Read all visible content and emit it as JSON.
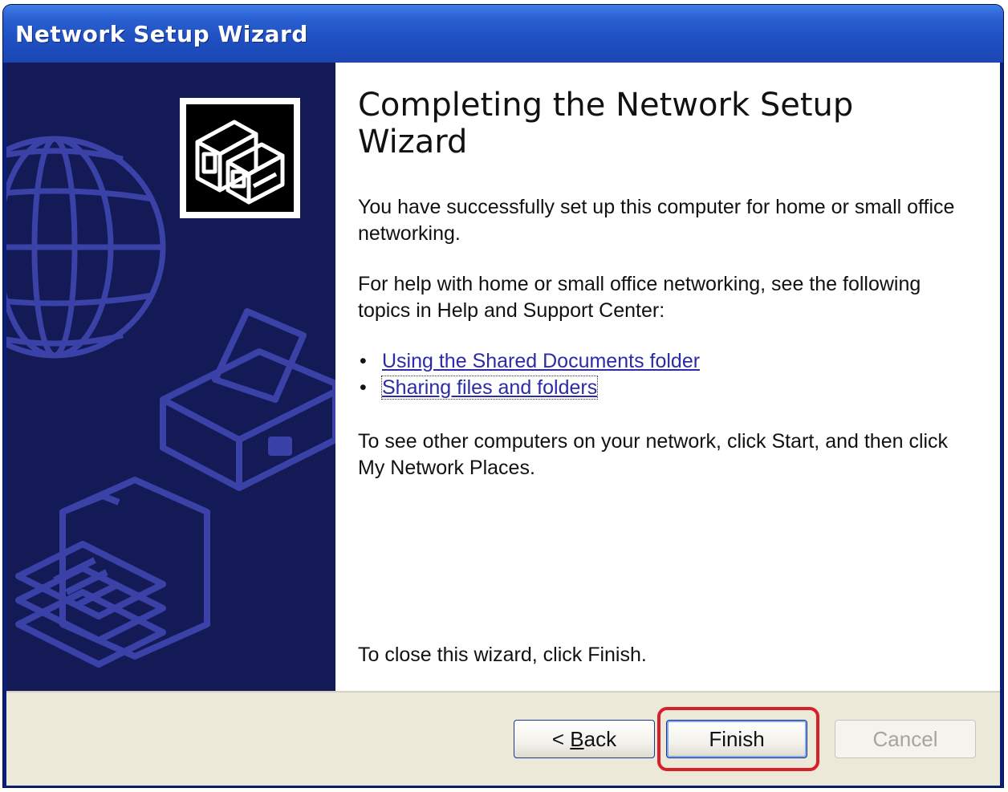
{
  "window": {
    "title": "Network Setup Wizard"
  },
  "content": {
    "heading": "Completing the Network Setup Wizard",
    "para1": "You have successfully set up this computer for home or small office networking.",
    "para2": "For help with home or small office networking, see the following topics in Help and Support Center:",
    "links": [
      {
        "label": "Using the Shared Documents folder"
      },
      {
        "label": "Sharing files and folders"
      }
    ],
    "para3": "To see other computers on your network, click Start, and then click My Network Places.",
    "para4": "To close this wizard, click Finish."
  },
  "buttons": {
    "back_prefix": "< ",
    "back_accel": "B",
    "back_rest": "ack",
    "finish": "Finish",
    "cancel": "Cancel"
  },
  "colors": {
    "titlebar": "#2a5fd0",
    "sidebar": "#141a55",
    "art": "#3a42a8",
    "link": "#2b2ba8",
    "highlight": "#d6202a"
  },
  "icons": {
    "wizard": "network-computers-icon",
    "globe": "globe-icon",
    "printer": "printer-icon",
    "folder": "folder-icon"
  }
}
